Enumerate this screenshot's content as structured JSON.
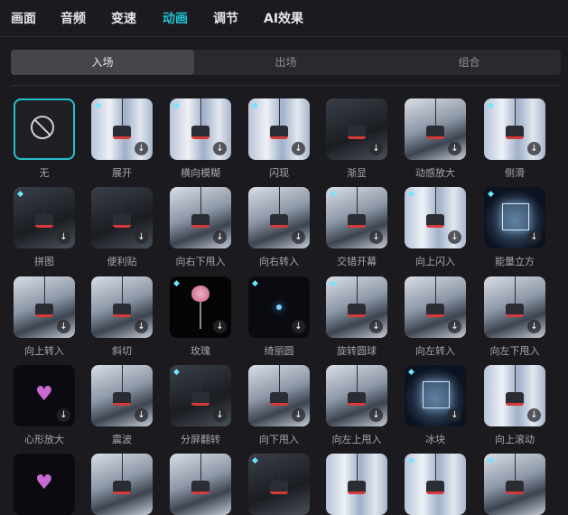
{
  "top_tabs": [
    "画面",
    "音频",
    "变速",
    "动画",
    "调节",
    "AI效果"
  ],
  "active_top_tab": "动画",
  "sub_tabs": [
    "入场",
    "出场",
    "组合"
  ],
  "active_sub_tab": "入场",
  "effects": [
    {
      "label": "无",
      "bg": "none",
      "gem": false,
      "dl": false
    },
    {
      "label": "展开",
      "bg": "blur",
      "gem": true,
      "dl": true
    },
    {
      "label": "横向模糊",
      "bg": "blur",
      "gem": true,
      "dl": true
    },
    {
      "label": "闪现",
      "bg": "blur",
      "gem": true,
      "dl": true
    },
    {
      "label": "渐显",
      "bg": "dark",
      "gem": false,
      "dl": true
    },
    {
      "label": "动感放大",
      "bg": "snow",
      "gem": false,
      "dl": true
    },
    {
      "label": "侧滑",
      "bg": "blur",
      "gem": true,
      "dl": true
    },
    {
      "label": "拼图",
      "bg": "dark",
      "gem": true,
      "dl": true
    },
    {
      "label": "便利贴",
      "bg": "dark",
      "gem": false,
      "dl": true
    },
    {
      "label": "向右下甩入",
      "bg": "snow",
      "gem": false,
      "dl": true
    },
    {
      "label": "向右转入",
      "bg": "snow",
      "gem": false,
      "dl": true
    },
    {
      "label": "交错开幕",
      "bg": "snow",
      "gem": true,
      "dl": true
    },
    {
      "label": "向上闪入",
      "bg": "blur",
      "gem": true,
      "dl": true
    },
    {
      "label": "能量立方",
      "bg": "ice",
      "gem": true,
      "dl": true
    },
    {
      "label": "向上转入",
      "bg": "snow",
      "gem": false,
      "dl": true
    },
    {
      "label": "斜切",
      "bg": "snow",
      "gem": false,
      "dl": true
    },
    {
      "label": "玫瑰",
      "bg": "rose",
      "gem": true,
      "dl": true
    },
    {
      "label": "绮丽圆",
      "bg": "black",
      "gem": true,
      "dl": true
    },
    {
      "label": "旋转圆球",
      "bg": "snow",
      "gem": true,
      "dl": true
    },
    {
      "label": "向左转入",
      "bg": "snow",
      "gem": false,
      "dl": true
    },
    {
      "label": "向左下甩入",
      "bg": "snow",
      "gem": false,
      "dl": true
    },
    {
      "label": "心形放大",
      "bg": "heart",
      "gem": false,
      "dl": true
    },
    {
      "label": "震波",
      "bg": "snow",
      "gem": false,
      "dl": true
    },
    {
      "label": "分屏翻转",
      "bg": "dark",
      "gem": true,
      "dl": true
    },
    {
      "label": "向下甩入",
      "bg": "snow",
      "gem": false,
      "dl": true
    },
    {
      "label": "向左上甩入",
      "bg": "snow",
      "gem": false,
      "dl": true
    },
    {
      "label": "冰块",
      "bg": "ice",
      "gem": true,
      "dl": true
    },
    {
      "label": "向上滚动",
      "bg": "blur",
      "gem": false,
      "dl": true
    },
    {
      "label": "",
      "bg": "heart",
      "gem": false,
      "dl": false
    },
    {
      "label": "",
      "bg": "snow",
      "gem": false,
      "dl": false
    },
    {
      "label": "",
      "bg": "snow",
      "gem": false,
      "dl": false
    },
    {
      "label": "",
      "bg": "dark",
      "gem": true,
      "dl": false
    },
    {
      "label": "",
      "bg": "blur",
      "gem": false,
      "dl": false
    },
    {
      "label": "",
      "bg": "blur",
      "gem": true,
      "dl": false
    },
    {
      "label": "",
      "bg": "snow",
      "gem": true,
      "dl": false
    }
  ],
  "icons": {
    "download": "download-icon",
    "premium": "diamond-icon",
    "none": "no-effect-icon"
  }
}
